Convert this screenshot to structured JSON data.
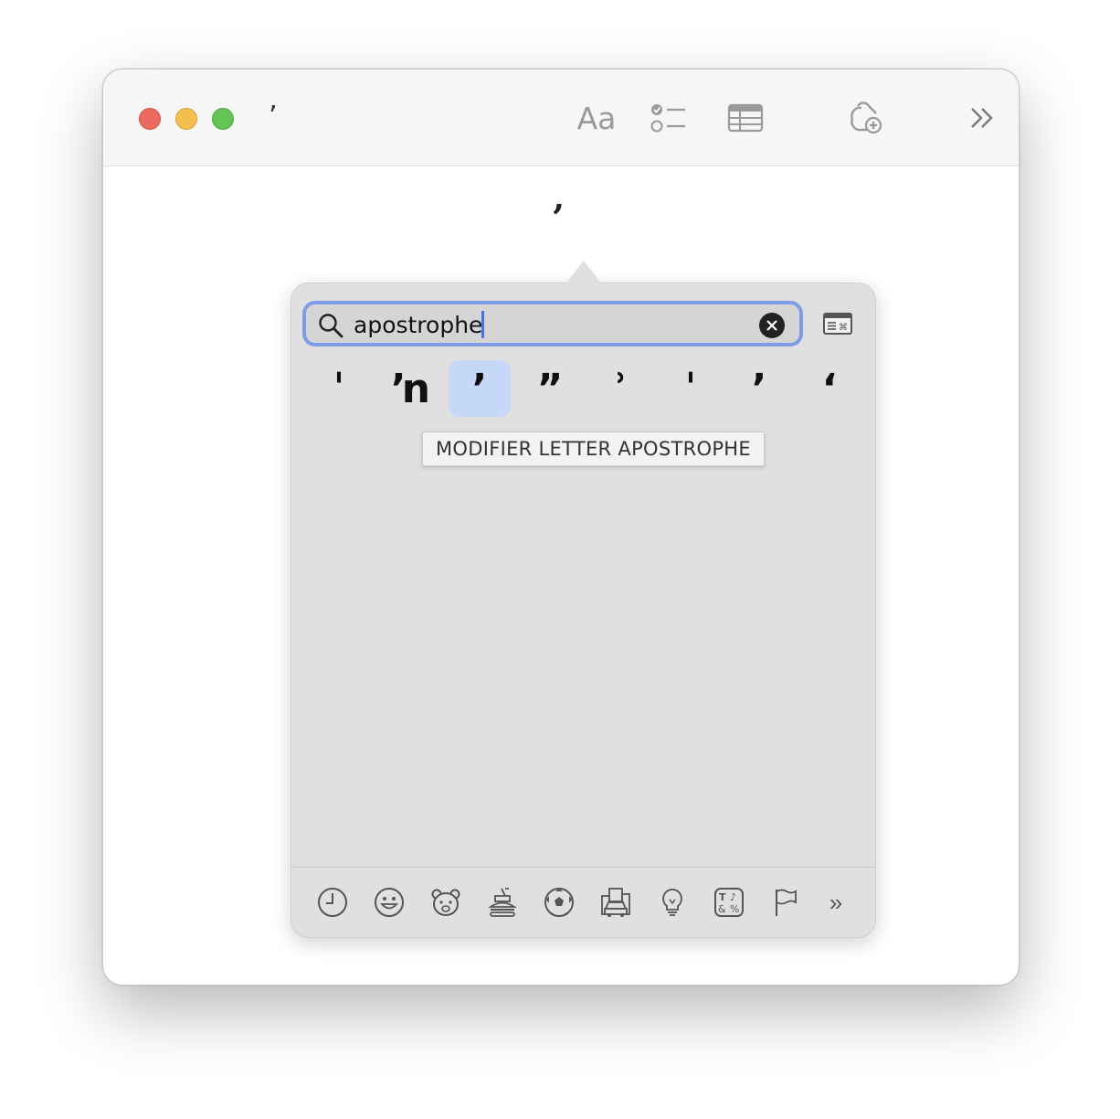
{
  "window": {
    "title": "ʼ",
    "document_char": "ʼ",
    "toolbar": {
      "format_label": "Aa",
      "more_label": "»"
    }
  },
  "palette": {
    "search": {
      "value": "apostrophe"
    },
    "results": [
      "ˈ",
      "ŉ",
      "ʼ",
      "ˮ",
      "ʾ",
      "ˈ",
      "ʼ",
      "ʻ"
    ],
    "selected_index": 2,
    "tooltip": "MODIFIER LETTER APOSTROPHE",
    "categories": {
      "more_label": "»"
    }
  },
  "colors": {
    "accent": "#7e9be8",
    "selection": "#c5d8f8",
    "close": "#ed6a5e",
    "minimize": "#f5bf4f",
    "zoom": "#62c554"
  }
}
